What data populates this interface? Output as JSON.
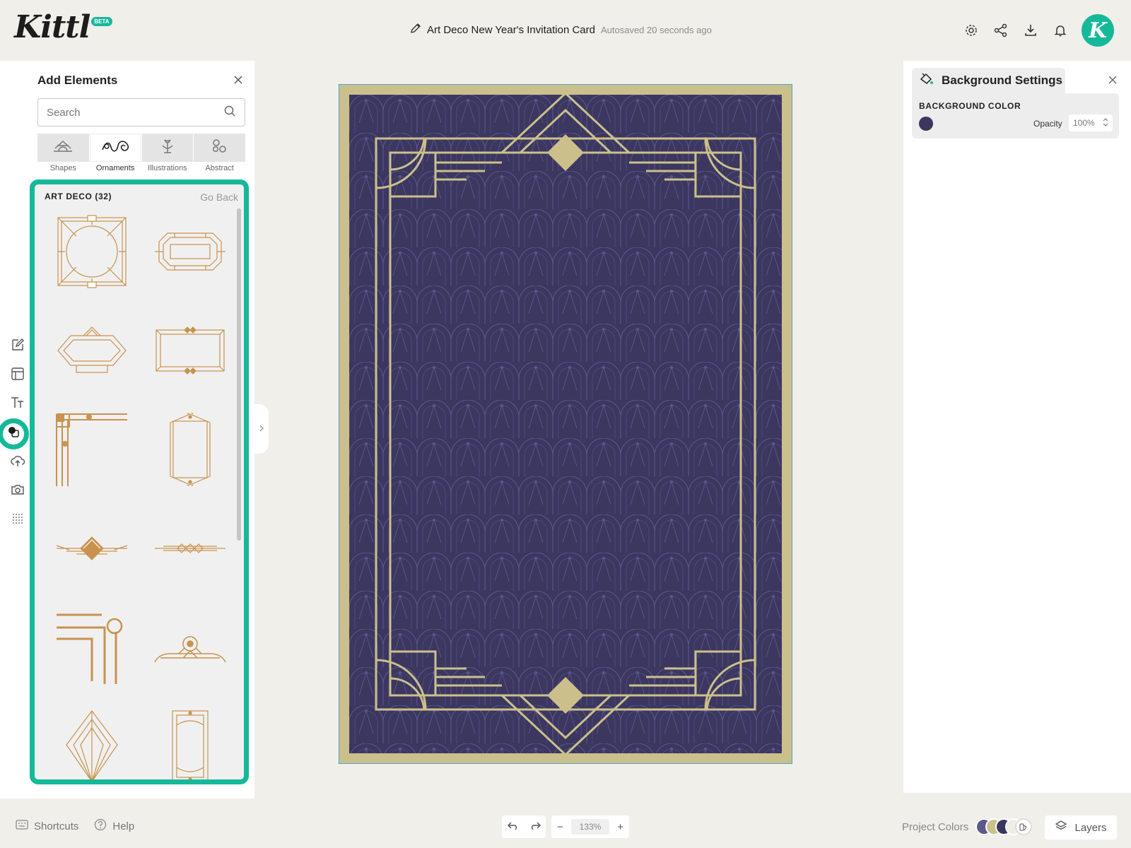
{
  "app": {
    "logo": "Kittl",
    "badge": "BETA"
  },
  "document": {
    "title": "Art Deco New Year's Invitation Card",
    "autosave": "Autosaved 20 seconds ago"
  },
  "header_icons": [
    "gear-icon",
    "share-icon",
    "download-icon",
    "bell-icon"
  ],
  "user": {
    "avatar_initial": "K"
  },
  "rail": {
    "items": [
      "edit-icon",
      "template-icon",
      "text-icon",
      "elements-icon",
      "upload-icon",
      "camera-icon",
      "dots-grid-icon"
    ],
    "active_index": 3
  },
  "add_panel": {
    "title": "Add Elements",
    "search_placeholder": "Search",
    "categories": [
      {
        "label": "Shapes"
      },
      {
        "label": "Ornaments",
        "active": true
      },
      {
        "label": "Illustrations"
      },
      {
        "label": "Abstract"
      }
    ],
    "section_title": "ART DECO (32)",
    "back_label": "Go Back",
    "ornament_color": "#c9924e"
  },
  "canvas": {
    "bg_color": "#3c375f",
    "frame_color": "#cbc08b",
    "pattern_color": "#5a5590"
  },
  "background_settings": {
    "title": "Background Settings",
    "section_label": "BACKGROUND COLOR",
    "color": "#3c375f",
    "opacity_label": "Opacity",
    "opacity_value": "100%"
  },
  "bottom": {
    "shortcuts_label": "Shortcuts",
    "help_label": "Help",
    "zoom_value": "133%",
    "zoom_minus": "−",
    "zoom_plus": "+",
    "project_colors_label": "Project Colors",
    "project_colors": [
      "#5c5889",
      "#cbc08b",
      "#3c375f",
      "#efeee6"
    ],
    "layers_label": "Layers"
  },
  "accent": "#15b99a"
}
